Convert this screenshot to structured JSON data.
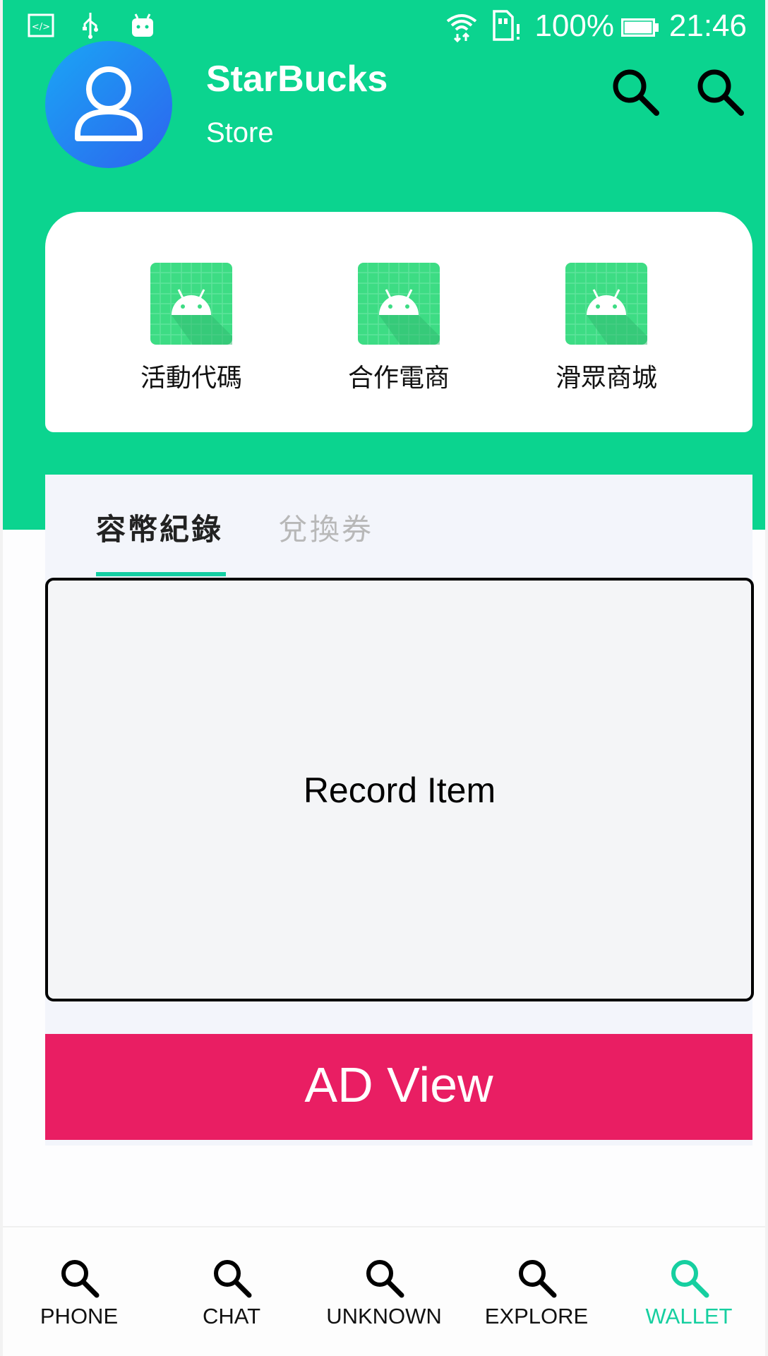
{
  "status_bar": {
    "battery_percent": "100%",
    "time": "21:46",
    "icons": [
      "code-icon",
      "usb-icon",
      "android-debug-icon",
      "wifi-icon",
      "sim-alert-icon",
      "battery-icon"
    ]
  },
  "header": {
    "store_name": "StarBucks",
    "store_subtitle": "Store",
    "avatar_icon": "person-icon",
    "actions": [
      "search-icon",
      "search-icon"
    ],
    "background_color": "#0bd48f"
  },
  "shortcuts": [
    {
      "label": "活動代碼",
      "icon": "android-app-icon"
    },
    {
      "label": "合作電商",
      "icon": "android-app-icon"
    },
    {
      "label": "滑眾商城",
      "icon": "android-app-icon"
    }
  ],
  "tabs": [
    {
      "label": "容幣紀錄",
      "active": true
    },
    {
      "label": "兌換券",
      "active": false
    }
  ],
  "record_item": {
    "label": "Record Item"
  },
  "ad_view": {
    "label": "AD View",
    "color": "#e91e63"
  },
  "bottom_nav": [
    {
      "label": "PHONE",
      "icon": "search-icon",
      "active": false
    },
    {
      "label": "CHAT",
      "icon": "search-icon",
      "active": false
    },
    {
      "label": "UNKNOWN",
      "icon": "search-icon",
      "active": false
    },
    {
      "label": "EXPLORE",
      "icon": "search-icon",
      "active": false
    },
    {
      "label": "WALLET",
      "icon": "search-icon",
      "active": true
    }
  ],
  "colors": {
    "accent": "#16cfa0",
    "tab_inactive": "#b8b8b8"
  }
}
